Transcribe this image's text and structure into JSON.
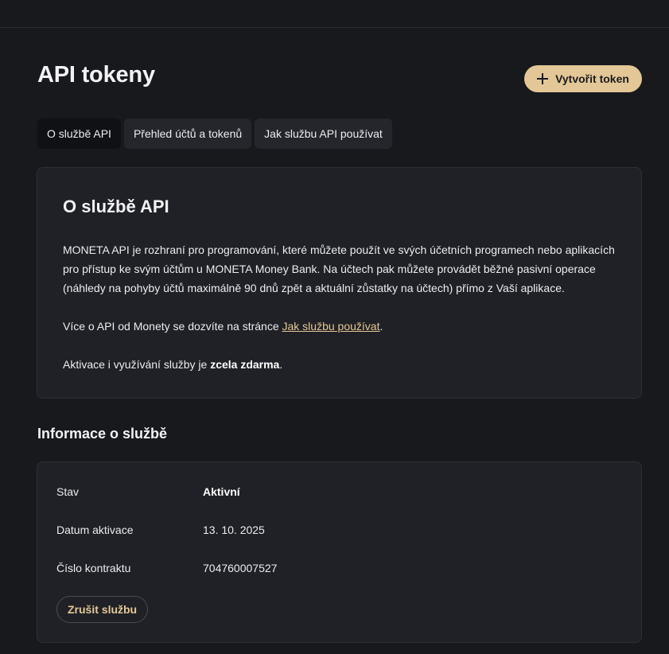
{
  "header": {
    "title": "API tokeny",
    "create_label": "Vytvořit token"
  },
  "tabs": [
    {
      "label": "O službě API",
      "active": true
    },
    {
      "label": "Přehled účtů a tokenů",
      "active": false
    },
    {
      "label": "Jak službu API používat",
      "active": false
    }
  ],
  "about": {
    "title": "O službě API",
    "paragraph1": "MONETA API je rozhraní pro programování, které můžete použít ve svých účetních programech nebo aplikacích pro přístup ke svým účtům u MONETA Money Bank. Na účtech pak můžete provádět běžné pasivní operace (náhledy na pohyby účtů maximálně 90 dnů zpět a aktuální zůstatky na účtech) přímo z Vaší aplikace.",
    "paragraph2_prefix": "Více o API od Monety se dozvíte na stránce ",
    "paragraph2_link": "Jak službu používat",
    "paragraph2_suffix": ".",
    "paragraph3_prefix": "Aktivace i využívání služby je ",
    "paragraph3_bold": "zcela zdarma",
    "paragraph3_suffix": "."
  },
  "info": {
    "section_title": "Informace o službě",
    "rows": [
      {
        "label": "Stav",
        "value": "Aktivní"
      },
      {
        "label": "Datum aktivace",
        "value": "13. 10. 2025"
      },
      {
        "label": "Číslo kontraktu",
        "value": "704760007527"
      }
    ],
    "cancel_label": "Zrušit službu"
  },
  "colors": {
    "accent": "#e3c796",
    "background": "#18191d",
    "card": "#202126"
  },
  "icons": {
    "create": "plus-icon"
  }
}
